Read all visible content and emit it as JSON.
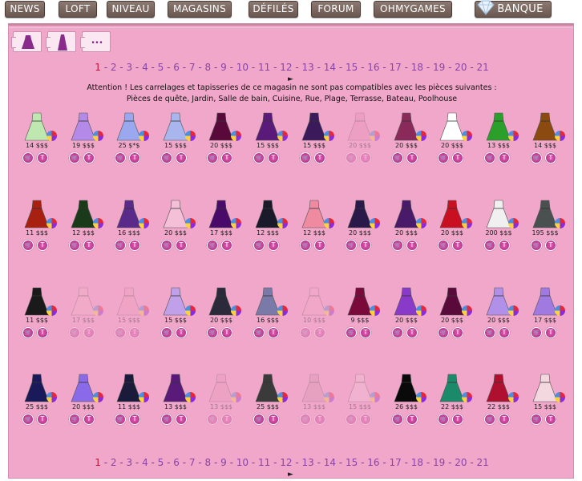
{
  "nav": {
    "items": [
      "NEWS",
      "LOFT",
      "NIVEAU",
      "MAGASINS",
      "DÉFILÉS",
      "FORUM",
      "OHMYGAMES",
      "BANQUE"
    ]
  },
  "tabs": {
    "more_label": "..."
  },
  "pagination": {
    "pages": [
      "1",
      "2",
      "3",
      "4",
      "5",
      "6",
      "7",
      "8",
      "9",
      "10",
      "11",
      "12",
      "13",
      "14",
      "15",
      "16",
      "17",
      "18",
      "19",
      "20",
      "21"
    ],
    "current": "1",
    "arrow": "►"
  },
  "notice": {
    "line1": "Attention ! Les carrelages et tapisseries de ce magasin ne sont pas compatibles avec les pièces suivantes :",
    "line2": "Pièces de quête, Jardin, Salle de bain, Cuisine, Rue, Plage, Terrasse, Bateau, Poolhouse"
  },
  "buttons": {
    "cart_symbol": "🛒",
    "try_symbol": "T"
  },
  "items": [
    {
      "price": "14 $$$",
      "color": "#bfe8b0",
      "faded": false
    },
    {
      "price": "19 $$$",
      "color": "#b48ae8",
      "faded": false
    },
    {
      "price": "25 $*$",
      "color": "#9aa8f0",
      "faded": false
    },
    {
      "price": "15 $$$",
      "color": "#a9b6ee",
      "faded": false
    },
    {
      "price": "20 $$$",
      "color": "#5a0a3a",
      "faded": false
    },
    {
      "price": "15 $$$",
      "color": "#5a1a7a",
      "faded": false
    },
    {
      "price": "15 $$$",
      "color": "#3a1a5a",
      "faded": false
    },
    {
      "price": "20 $$$",
      "color": "#e890b8",
      "faded": true
    },
    {
      "price": "20 $$$",
      "color": "#8a2a5a",
      "faded": false
    },
    {
      "price": "20 $$$",
      "color": "#ffffff",
      "faded": false
    },
    {
      "price": "13 $$$",
      "color": "#2aa02a",
      "faded": false
    },
    {
      "price": "14 $$$",
      "color": "#8a4a10",
      "faded": false
    },
    {
      "price": "11 $$$",
      "color": "#a82010",
      "faded": false
    },
    {
      "price": "12 $$$",
      "color": "#1a3a1a",
      "faded": false
    },
    {
      "price": "16 $$$",
      "color": "#5a2a8a",
      "faded": false
    },
    {
      "price": "20 $$$",
      "color": "#f4c0d8",
      "faded": false
    },
    {
      "price": "17 $$$",
      "color": "#4a0a6a",
      "faded": false
    },
    {
      "price": "12 $$$",
      "color": "#1a1a2a",
      "faded": false
    },
    {
      "price": "12 $$$",
      "color": "#f08aa0",
      "faded": false
    },
    {
      "price": "20 $$$",
      "color": "#2a1a4a",
      "faded": false
    },
    {
      "price": "20 $$$",
      "color": "#4a1a6a",
      "faded": false
    },
    {
      "price": "20 $$$",
      "color": "#c81020",
      "faded": false
    },
    {
      "price": "200 $$$",
      "color": "#f0f0f0",
      "faded": false
    },
    {
      "price": "195 $$$",
      "color": "#4a5050",
      "faded": false
    },
    {
      "price": "11 $$$",
      "color": "#1a1a1a",
      "faded": false
    },
    {
      "price": "17 $$$",
      "color": "#f4b4c8",
      "faded": true
    },
    {
      "price": "15 $$$",
      "color": "#f0a0c0",
      "faded": true
    },
    {
      "price": "15 $$$",
      "color": "#c0a0e8",
      "faded": false
    },
    {
      "price": "20 $$$",
      "color": "#2a2a3a",
      "faded": false
    },
    {
      "price": "16 $$$",
      "color": "#7a7aa8",
      "faded": false
    },
    {
      "price": "10 $$$",
      "color": "#f0a8c8",
      "faded": true
    },
    {
      "price": "9 $$$",
      "color": "#7a0a3a",
      "faded": false
    },
    {
      "price": "20 $$$",
      "color": "#8a3ac8",
      "faded": false
    },
    {
      "price": "20 $$$",
      "color": "#5a0a3a",
      "faded": false
    },
    {
      "price": "20 $$$",
      "color": "#b090e8",
      "faded": false
    },
    {
      "price": "17 $$$",
      "color": "#a07ae0",
      "faded": false
    },
    {
      "price": "25 $$$",
      "color": "#1a1a5a",
      "faded": false
    },
    {
      "price": "20 $$$",
      "color": "#8a6ae8",
      "faded": false
    },
    {
      "price": "11 $$$",
      "color": "#1a1a3a",
      "faded": false
    },
    {
      "price": "13 $$$",
      "color": "#5a1a7a",
      "faded": false
    },
    {
      "price": "13 $$$",
      "color": "#e898b8",
      "faded": true
    },
    {
      "price": "25 $$$",
      "color": "#3a3a3a",
      "faded": false
    },
    {
      "price": "13 $$$",
      "color": "#d898b0",
      "faded": true
    },
    {
      "price": "15 $$$",
      "color": "#f0c8d8",
      "faded": true
    },
    {
      "price": "26 $$$",
      "color": "#0a0a0a",
      "faded": false
    },
    {
      "price": "22 $$$",
      "color": "#1a8a6a",
      "faded": false
    },
    {
      "price": "22 $$$",
      "color": "#b01030",
      "faded": false
    },
    {
      "price": "15 $$$",
      "color": "#f4d8e0",
      "faded": false
    }
  ]
}
